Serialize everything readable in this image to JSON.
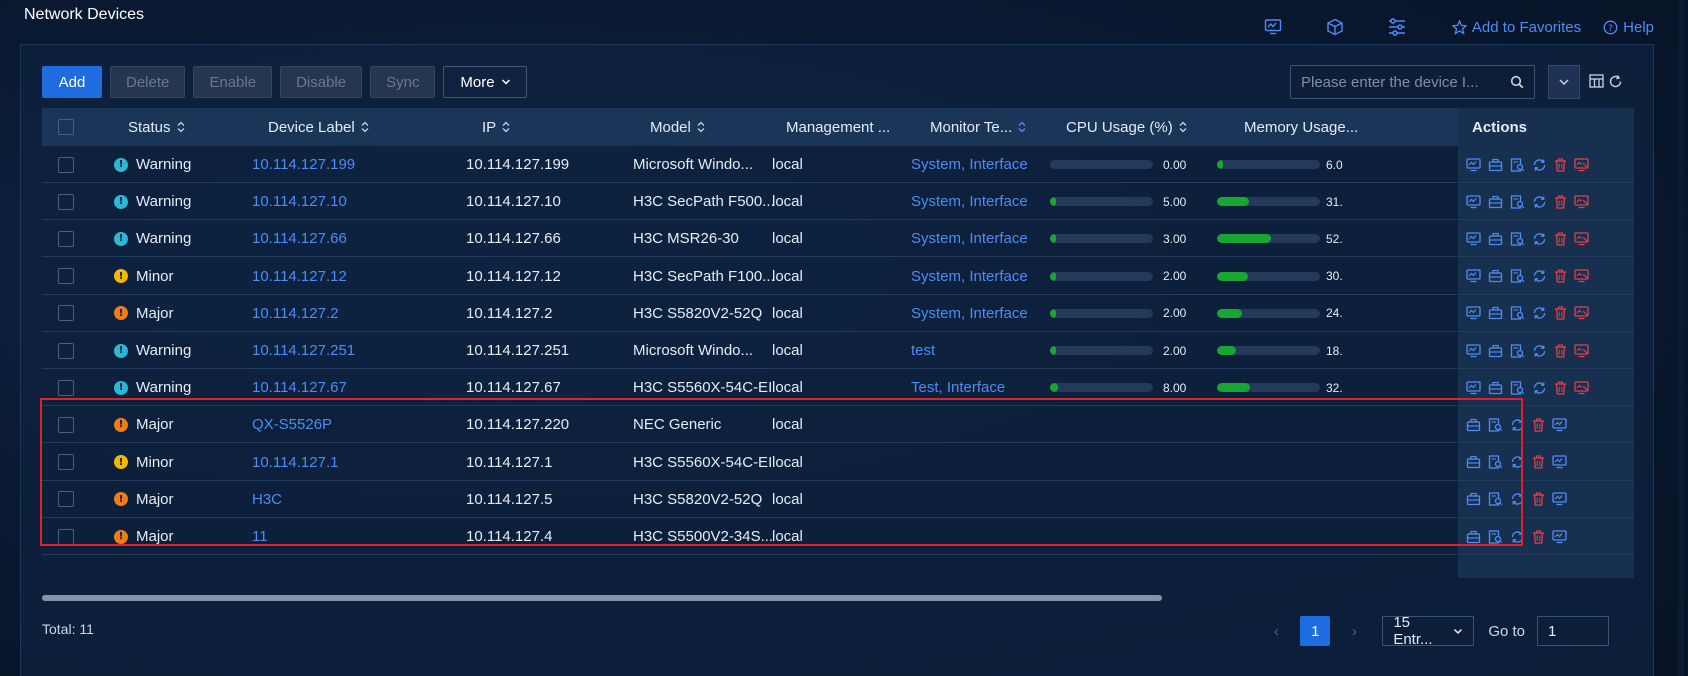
{
  "page_title": "Network Devices",
  "top_bar": {
    "add_favorites": "Add to Favorites",
    "help": "Help"
  },
  "toolbar": {
    "add": "Add",
    "delete": "Delete",
    "enable": "Enable",
    "disable": "Disable",
    "sync": "Sync",
    "more": "More"
  },
  "search": {
    "placeholder": "Please enter the device I..."
  },
  "columns": {
    "status": "Status",
    "device_label": "Device Label",
    "ip": "IP",
    "model": "Model",
    "management": "Management ...",
    "monitor_template": "Monitor Te...",
    "cpu_usage": "CPU Usage (%)",
    "memory_usage": "Memory Usage...",
    "actions": "Actions"
  },
  "rows": [
    {
      "status": "Warning",
      "level": "warning",
      "label": "10.114.127.199",
      "ip": "10.114.127.199",
      "model": "Microsoft Windo...",
      "mgmt": "local",
      "monitor": "System, Interface",
      "cpu": "0.00",
      "cpu_frac": 0.0,
      "mem": "6.0",
      "mem_frac": 0.06,
      "full_actions": true
    },
    {
      "status": "Warning",
      "level": "warning",
      "label": "10.114.127.10",
      "ip": "10.114.127.10",
      "model": "H3C SecPath F500...",
      "mgmt": "local",
      "monitor": "System, Interface",
      "cpu": "5.00",
      "cpu_frac": 0.05,
      "mem": "31.",
      "mem_frac": 0.31,
      "full_actions": true
    },
    {
      "status": "Warning",
      "level": "warning",
      "label": "10.114.127.66",
      "ip": "10.114.127.66",
      "model": "H3C MSR26-30",
      "mgmt": "local",
      "monitor": "System, Interface",
      "cpu": "3.00",
      "cpu_frac": 0.03,
      "mem": "52.",
      "mem_frac": 0.52,
      "full_actions": true
    },
    {
      "status": "Minor",
      "level": "minor",
      "label": "10.114.127.12",
      "ip": "10.114.127.12",
      "model": "H3C SecPath F100...",
      "mgmt": "local",
      "monitor": "System, Interface",
      "cpu": "2.00",
      "cpu_frac": 0.02,
      "mem": "30.",
      "mem_frac": 0.3,
      "full_actions": true
    },
    {
      "status": "Major",
      "level": "major",
      "label": "10.114.127.2",
      "ip": "10.114.127.2",
      "model": "H3C S5820V2-52Q",
      "mgmt": "local",
      "monitor": "System, Interface",
      "cpu": "2.00",
      "cpu_frac": 0.02,
      "mem": "24.",
      "mem_frac": 0.24,
      "full_actions": true
    },
    {
      "status": "Warning",
      "level": "warning",
      "label": "10.114.127.251",
      "ip": "10.114.127.251",
      "model": "Microsoft Windo...",
      "mgmt": "local",
      "monitor": "test",
      "cpu": "2.00",
      "cpu_frac": 0.02,
      "mem": "18.",
      "mem_frac": 0.18,
      "full_actions": true
    },
    {
      "status": "Warning",
      "level": "warning",
      "label": "10.114.127.67",
      "ip": "10.114.127.67",
      "model": "H3C S5560X-54C-EI",
      "mgmt": "local",
      "monitor": "Test, Interface",
      "cpu": "8.00",
      "cpu_frac": 0.08,
      "mem": "32.",
      "mem_frac": 0.32,
      "full_actions": true
    },
    {
      "status": "Major",
      "level": "major",
      "label": "QX-S5526P",
      "ip": "10.114.127.220",
      "model": "NEC Generic",
      "mgmt": "local",
      "monitor": "",
      "cpu": "",
      "mem": "",
      "full_actions": false
    },
    {
      "status": "Minor",
      "level": "minor",
      "label": "10.114.127.1",
      "ip": "10.114.127.1",
      "model": "H3C S5560X-54C-EI",
      "mgmt": "local",
      "monitor": "",
      "cpu": "",
      "mem": "",
      "full_actions": false
    },
    {
      "status": "Major",
      "level": "major",
      "label": "H3C",
      "ip": "10.114.127.5",
      "model": "H3C S5820V2-52Q",
      "mgmt": "local",
      "monitor": "",
      "cpu": "",
      "mem": "",
      "full_actions": false
    },
    {
      "status": "Major",
      "level": "major",
      "label": "11",
      "ip": "10.114.127.4",
      "model": "H3C S5500V2-34S...",
      "mgmt": "local",
      "monitor": "",
      "cpu": "",
      "mem": "",
      "full_actions": false
    }
  ],
  "footer": {
    "total": "Total: 11",
    "current_page": "1",
    "page_size": "15 Entr...",
    "goto_label": "Go to",
    "goto_value": "1"
  },
  "colors": {
    "warning": "#2cb7d6",
    "minor": "#f5b800",
    "major": "#f07c16",
    "accent": "#1f6ce0",
    "link": "#4d8cf5",
    "bar_fill": "#17a632",
    "danger": "#e0424a"
  }
}
